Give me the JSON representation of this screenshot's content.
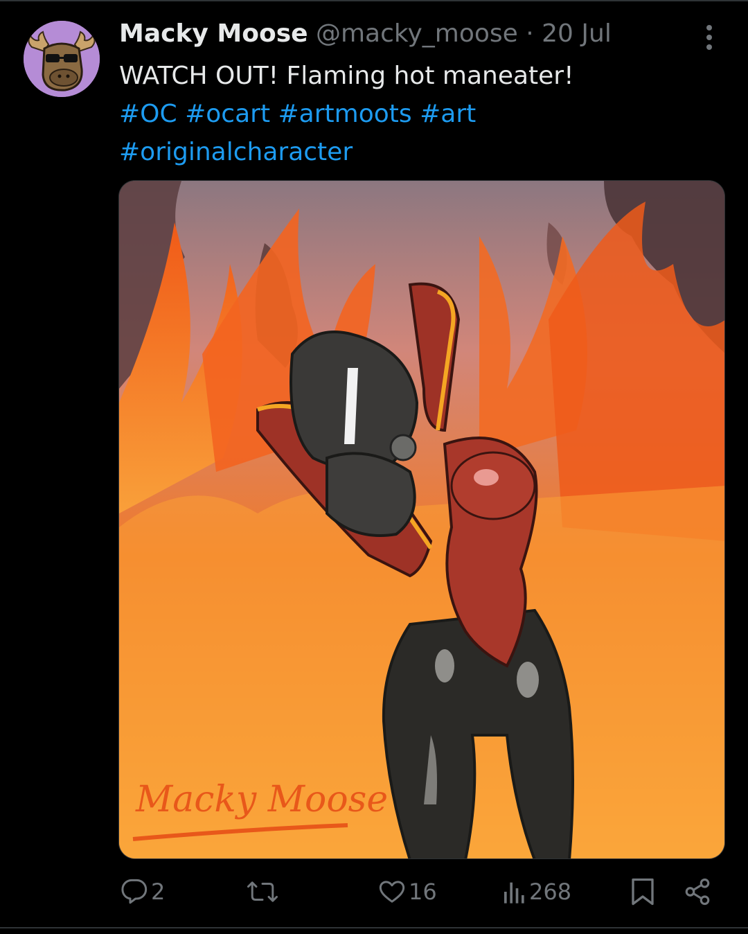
{
  "post": {
    "author": {
      "display_name": "Macky Moose",
      "handle": "@macky_moose",
      "avatar_icon": "moose-avatar"
    },
    "separator": " · ",
    "date": "20 Jul",
    "text": "WATCH OUT! Flaming hot maneater!",
    "hashtags": [
      "#OC",
      "#ocart",
      "#artmoots",
      "#art",
      "#originalcharacter"
    ],
    "media": {
      "signature_text": "Macky Moose",
      "description_icon": "artwork-image"
    },
    "actions": {
      "replies": "2",
      "reposts": "",
      "likes": "16",
      "views": "268"
    }
  },
  "icons": {
    "more": "more-vertical-icon",
    "reply": "reply-icon",
    "repost": "repost-icon",
    "like": "heart-icon",
    "views": "views-chart-icon",
    "bookmark": "bookmark-icon",
    "share": "share-icon"
  },
  "colors": {
    "background": "#000000",
    "text_primary": "#e7e9ea",
    "text_secondary": "#71767b",
    "link": "#1d9bf0",
    "border": "#2f3336",
    "avatar_bg": "#b58cd6"
  }
}
